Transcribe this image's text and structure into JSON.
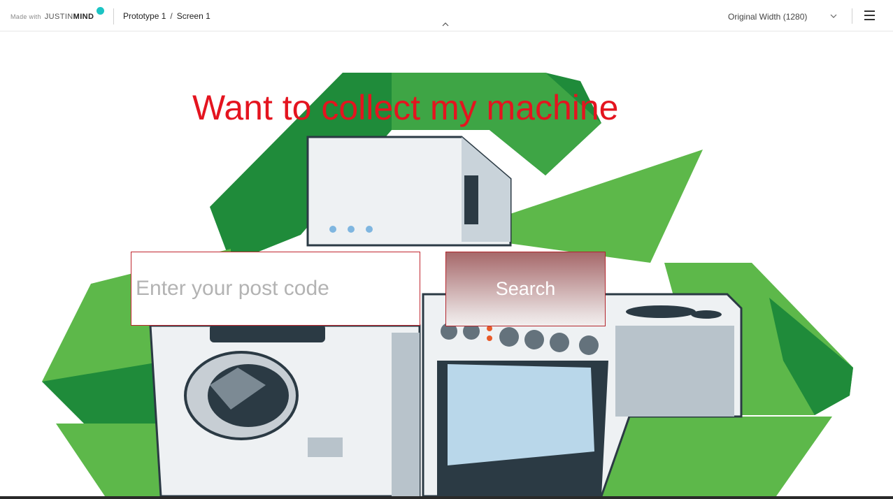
{
  "topbar": {
    "made_with": "Made with",
    "brand_thin": "JUSTIN",
    "brand_bold": "MIND",
    "breadcrumb": [
      "Prototype 1",
      "/",
      "Screen 1"
    ],
    "width_select": "Original Width (1280)",
    "icons": {
      "collapse": "chevron-up-icon",
      "width_dropdown": "chevron-down-icon",
      "menu": "hamburger-menu-icon"
    }
  },
  "hero": {
    "title": "Want to collect my machine",
    "postcode_placeholder": "Enter your post code",
    "postcode_value": "",
    "search_label": "Search"
  },
  "colors": {
    "title": "#e4141f",
    "brand_dot": "#1cc4c4",
    "recycle_green_dark": "#1f8b3a",
    "recycle_green_light": "#5db84a",
    "button_border": "#b3262d"
  }
}
